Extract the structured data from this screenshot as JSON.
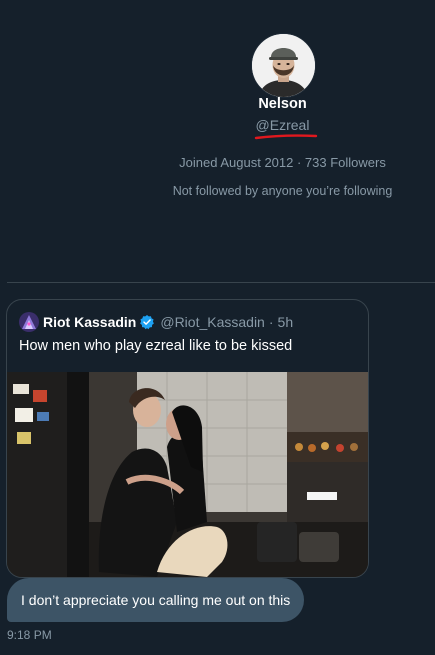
{
  "profile": {
    "name": "Nelson",
    "handle": "@Ezreal",
    "meta": "Joined August 2012 · 733 Followers",
    "follow_note": "Not followed by anyone you’re following"
  },
  "quoted_tweet": {
    "author_name": "Riot Kassadin",
    "author_handle": "@Riot_Kassadin",
    "separator": "·",
    "time_ago": "5h",
    "text": "How men who play ezreal like to be kissed",
    "verified": true
  },
  "message": {
    "text": "I don’t appreciate you calling me out on this",
    "timestamp": "9:18 PM"
  },
  "colors": {
    "background": "#15202b",
    "bubble": "#3d5466",
    "secondary_text": "#8899a6",
    "verified_badge": "#1da1f2",
    "annotation_underline": "#e0181e"
  }
}
